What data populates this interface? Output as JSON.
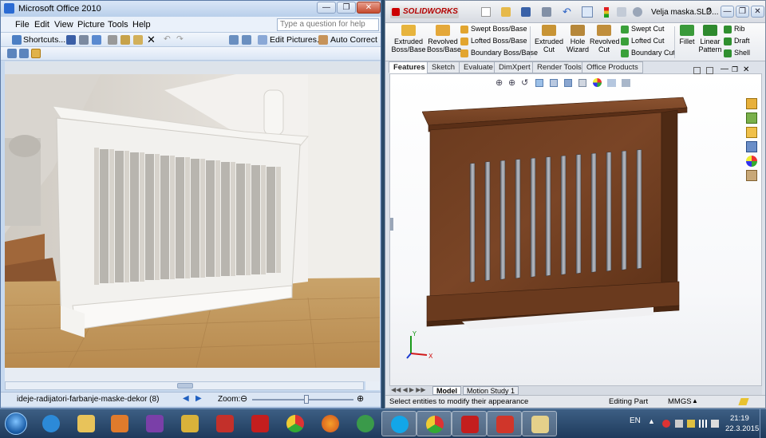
{
  "left_window": {
    "title": "Microsoft Office 2010",
    "menu": [
      "File",
      "Edit",
      "View",
      "Picture",
      "Tools",
      "Help"
    ],
    "help_placeholder": "Type a question for help",
    "toolbar": {
      "shortcuts": "Shortcuts...",
      "edit_pictures": "Edit Pictures...",
      "auto_correct": "Auto Correct"
    },
    "status": {
      "filename": "ideje-radijatori-farbanje-maske-dekor (8)",
      "zoom_label": "Zoom:"
    }
  },
  "right_window": {
    "logo": "SOLIDWORKS",
    "title": "Velja maska.SLD...",
    "help_mark": "?",
    "commands_big": [
      "Extruded Boss/Base",
      "Revolved Boss/Base",
      "Extruded Cut",
      "Hole Wizard",
      "Revolved Cut",
      "Fillet",
      "Linear Pattern"
    ],
    "commands_small": [
      "Swept Boss/Base",
      "Lofted Boss/Base",
      "Boundary Boss/Base",
      "Swept Cut",
      "Lofted Cut",
      "Boundary Cut",
      "Rib",
      "Draft",
      "Shell"
    ],
    "tabs": [
      "Features",
      "Sketch",
      "Evaluate",
      "DimXpert",
      "Render Tools",
      "Office Products"
    ],
    "bottom_tabs": [
      "Model",
      "Motion Study 1"
    ],
    "status": {
      "message": "Select entities to modify their appearance",
      "mode": "Editing Part",
      "units": "MMGS"
    },
    "triad": {
      "y": "Y",
      "x": "X"
    }
  },
  "taskbar": {
    "apps": [
      "windows-explorer",
      "internet-explorer",
      "media-player",
      "visual-studio",
      "design-app",
      "acrobat",
      "solidworks",
      "chrome",
      "firefox",
      "editor",
      "skype",
      "chrome",
      "solidworks",
      "presentation",
      "paint"
    ],
    "language": "EN",
    "time": "21:19",
    "date": "22.3.2015"
  },
  "colors": {
    "office_chrome": "#c7d9ef",
    "sw_red": "#b30000",
    "wood": "#6e3a1c",
    "taskbar": "#2a4a6a"
  }
}
